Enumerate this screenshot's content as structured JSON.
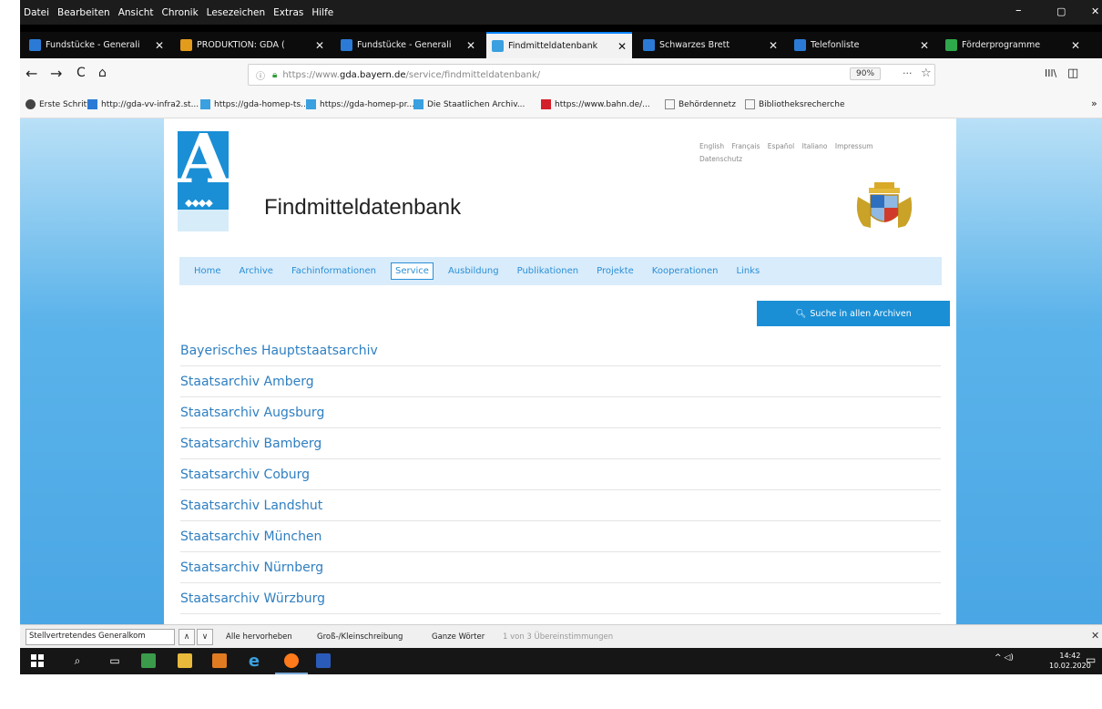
{
  "menubar": {
    "items": [
      "Datei",
      "Bearbeiten",
      "Ansicht",
      "Chronik",
      "Lesezeichen",
      "Extras",
      "Hilfe"
    ],
    "controls": {
      "minimize": "–",
      "maximize": "▢",
      "close": "✕"
    }
  },
  "tabs": [
    {
      "label": "Fundstücke - Generali",
      "fav": "#2b7bd6",
      "active": false
    },
    {
      "label": "PRODUKTION: GDA (",
      "fav": "#e39b1b",
      "active": false
    },
    {
      "label": "Fundstücke - Generali",
      "fav": "#2b7bd6",
      "active": false
    },
    {
      "label": "Findmitteldatenbank",
      "fav": "#3aa0e0",
      "active": true
    },
    {
      "label": "Schwarzes Brett",
      "fav": "#2b7bd6",
      "active": false
    },
    {
      "label": "Telefonliste",
      "fav": "#2b7bd6",
      "active": false
    },
    {
      "label": "Förderprogramme",
      "fav": "#2ea84a",
      "active": false
    }
  ],
  "tab_close": "✕",
  "nav": {
    "back": "←",
    "forward": "→",
    "reload": "C",
    "home": "⌂",
    "url_prefix": "https://www.",
    "url_domain": "gda.bayern.de",
    "url_path": "/service/findmitteldatenbank/",
    "zoom": "90%",
    "more": "···",
    "star": "☆",
    "library": "IIl\\",
    "sidebar": "◫"
  },
  "bookmarks": [
    {
      "label": "Erste Schritte",
      "icon": "#444444"
    },
    {
      "label": "http://gda-vv-infra2.st...",
      "icon": "#2b7bd6"
    },
    {
      "label": "https://gda-homep-ts...",
      "icon": "#3aa0e0"
    },
    {
      "label": "https://gda-homep-pr...",
      "icon": "#3aa0e0"
    },
    {
      "label": "Die Staatlichen Archiv...",
      "icon": "#3aa0e0"
    },
    {
      "label": "https://www.bahn.de/...",
      "icon": "#d3202a"
    },
    {
      "label": "Behördennetz",
      "icon": "#888888"
    },
    {
      "label": "Bibliotheksrecherche",
      "icon": "#888888"
    }
  ],
  "bookmarks_more": "»",
  "site": {
    "title": "Findmitteldatenbank",
    "languages": [
      "English",
      "Français",
      "Español",
      "Italiano",
      "Impressum",
      "Datenschutz"
    ],
    "nav": [
      {
        "label": "Home",
        "active": false
      },
      {
        "label": "Archive",
        "active": false
      },
      {
        "label": "Fachinformationen",
        "active": false
      },
      {
        "label": "Service",
        "active": true
      },
      {
        "label": "Ausbildung",
        "active": false
      },
      {
        "label": "Publikationen",
        "active": false
      },
      {
        "label": "Projekte",
        "active": false
      },
      {
        "label": "Kooperationen",
        "active": false
      },
      {
        "label": "Links",
        "active": false
      }
    ],
    "search_button": "Suche in allen Archiven",
    "archives": [
      "Bayerisches Hauptstaatsarchiv",
      "Staatsarchiv Amberg",
      "Staatsarchiv Augsburg",
      "Staatsarchiv Bamberg",
      "Staatsarchiv Coburg",
      "Staatsarchiv Landshut",
      "Staatsarchiv München",
      "Staatsarchiv Nürnberg",
      "Staatsarchiv Würzburg"
    ]
  },
  "findbar": {
    "value": "Stellvertretendes Generalkom",
    "up": "∧",
    "down": "∨",
    "highlight_all": "Alle hervorheben",
    "match_case": "Groß-/Kleinschreibung",
    "whole_words": "Ganze Wörter",
    "result": "1 von 3 Übereinstimmungen",
    "close": "✕"
  },
  "taskbar": {
    "tray": "^ ◁)",
    "time": "14:42",
    "date": "10.02.2020",
    "notifications": "▭"
  }
}
